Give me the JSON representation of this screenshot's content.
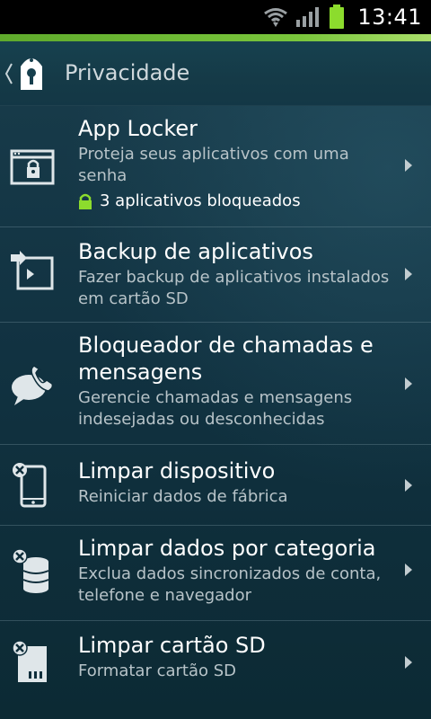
{
  "status": {
    "time": "13:41",
    "icons": [
      "wifi-icon",
      "signal-icon",
      "battery-icon"
    ],
    "accent_color": "#7ac63c"
  },
  "header": {
    "title": "Privacidade",
    "app_icon": "keyhole-lock-icon"
  },
  "items": [
    {
      "title": "App Locker",
      "subtitle": "Proteja seus aplicativos com uma senha",
      "status_text": "3 aplicativos bloqueados",
      "icon": "locked-window-icon"
    },
    {
      "title": "Backup de aplicativos",
      "subtitle": "Fazer backup de aplicativos instalados em cartão SD",
      "icon": "app-backup-icon"
    },
    {
      "title": "Bloqueador de chamadas e mensagens",
      "subtitle": "Gerencie chamadas e mensagens indesejadas ou desconhecidas",
      "icon": "call-message-block-icon"
    },
    {
      "title": "Limpar dispositivo",
      "subtitle": "Reiniciar dados de fábrica",
      "icon": "wipe-device-icon"
    },
    {
      "title": "Limpar dados por categoria",
      "subtitle": "Exclua dados sincronizados de conta, telefone e navegador",
      "icon": "wipe-data-category-icon"
    },
    {
      "title": "Limpar cartão SD",
      "subtitle": "Formatar cartão SD",
      "icon": "wipe-sd-card-icon"
    }
  ]
}
